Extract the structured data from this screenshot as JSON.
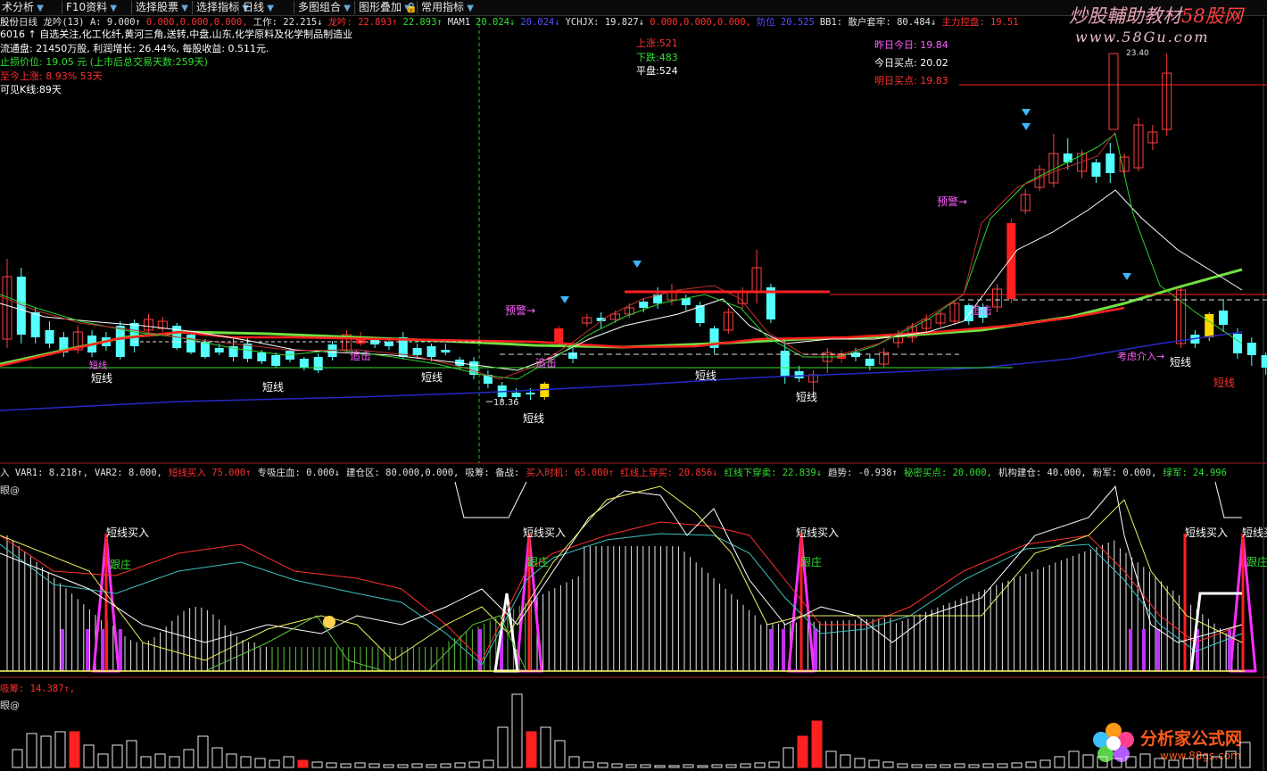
{
  "toolbar": [
    {
      "label": "术分析",
      "dropdown": true
    },
    {
      "label": "F10资料",
      "dropdown": true
    },
    {
      "label": "选择股票",
      "dropdown": true
    },
    {
      "label": "选择指标",
      "dropdown": true
    },
    {
      "label": "日线",
      "dropdown": true
    },
    {
      "label": "多图组合",
      "dropdown": true
    },
    {
      "label": "图形叠加",
      "dropdown": true
    },
    {
      "label": "常用指标",
      "dropdown": true
    }
  ],
  "main_header": {
    "stock": "股份",
    "period": "日线",
    "indicator": "龙吟(13)",
    "vals": [
      {
        "t": "A: 9.000↑",
        "c": "#e0e0e0"
      },
      {
        "t": "0.000,0.000,0.000,",
        "c": "#ff3030"
      },
      {
        "t": "工作: 22.215↓",
        "c": "#e0e0e0"
      },
      {
        "t": "龙吟: 22.893↑",
        "c": "#ff3030"
      },
      {
        "t": "22.893↑",
        "c": "#30e030"
      },
      {
        "t": "MAM1",
        "c": "#e0e0e0"
      },
      {
        "t": "20.024↓",
        "c": "#30e030"
      },
      {
        "t": "20.024↓",
        "c": "#5050ff"
      },
      {
        "t": "YCHJX: 19.827↓",
        "c": "#e0e0e0"
      },
      {
        "t": "0.000,0.000,0.000,",
        "c": "#ff3030"
      },
      {
        "t": "防位",
        "c": "#5050ff"
      },
      {
        "t": "20.525",
        "c": "#5050ff"
      },
      {
        "t": "BB1: 散户套牢: 80.484↓",
        "c": "#e0e0e0"
      },
      {
        "t": "主力控盘: 19.51",
        "c": "#ff3030"
      }
    ]
  },
  "info_lines": [
    {
      "t": "6016 ↑ 自选关注,化工化纤,黄河三角,送转,中盘,山东,化学原料及化学制品制造业",
      "c": "#ffffff"
    },
    {
      "t": "流通盘: 21450万股, 利润增长: 26.44%, 每股收益: 0.511元.",
      "c": "#ffffff"
    },
    {
      "t": "止损价位: 19.05 元  (上市后总交易天数:259天)",
      "c": "#30e030"
    },
    {
      "t": "至今上涨: 8.93%  53天",
      "c": "#ff3030"
    },
    {
      "t": "可见K线:89天",
      "c": "#ffffff"
    }
  ],
  "market_stats": [
    {
      "t": "上涨:521",
      "c": "#ff3030"
    },
    {
      "t": "下跌:483",
      "c": "#30e030"
    },
    {
      "t": "平盘:524",
      "c": "#ffffff"
    }
  ],
  "buy_points": [
    {
      "t": "昨日今日: 19.84",
      "c": "#ff60ff"
    },
    {
      "t": "今日买点: 20.02",
      "c": "#ffffff"
    },
    {
      "t": "明日买点: 19.83",
      "c": "#ff3030"
    }
  ],
  "chart_labels": {
    "short": "短线",
    "warning": "预警→",
    "pursuit": "追击",
    "follow": "跟庄",
    "short_buy": "短线买入",
    "consider": "考虑介入→",
    "low_price": "18.36",
    "top_price": "23.40"
  },
  "sub_header": {
    "vals": [
      {
        "t": "入 VAR1: 8.218↑,",
        "c": "#e0e0e0"
      },
      {
        "t": "VAR2: 8.000,",
        "c": "#e0e0e0"
      },
      {
        "t": "短线买入  75.000↑",
        "c": "#ff3030"
      },
      {
        "t": "专吸庄血: 0.000↓",
        "c": "#e0e0e0"
      },
      {
        "t": "建仓区: 80.000,0.000,",
        "c": "#e0e0e0"
      },
      {
        "t": "吸筹: 备战:",
        "c": "#e0e0e0"
      },
      {
        "t": "买入时机: 65.000↑",
        "c": "#ff3030"
      },
      {
        "t": "红线上穿买: 20.856↓",
        "c": "#ff3030"
      },
      {
        "t": "红线下穿卖: 22.839↓",
        "c": "#30e030"
      },
      {
        "t": "趋势: -0.938↑",
        "c": "#e0e0e0"
      },
      {
        "t": "秘密买点: 20.000,",
        "c": "#30e030"
      },
      {
        "t": "机构建仓: 40.000,",
        "c": "#e0e0e0"
      },
      {
        "t": "粉军: 0.000,",
        "c": "#e0e0e0"
      },
      {
        "t": "绿军: 24.996",
        "c": "#30e030"
      }
    ],
    "name": "眼@"
  },
  "vol_header": {
    "t": "吸筹: 14.387↑,",
    "name": "眼@"
  },
  "watermark_top": {
    "brand": "炒股輔助教材",
    "site": "58股网",
    "url": "www.58Gu.com"
  },
  "watermark_bottom": {
    "brand": "分析家公式网",
    "url": "www.88gs.com"
  }
}
